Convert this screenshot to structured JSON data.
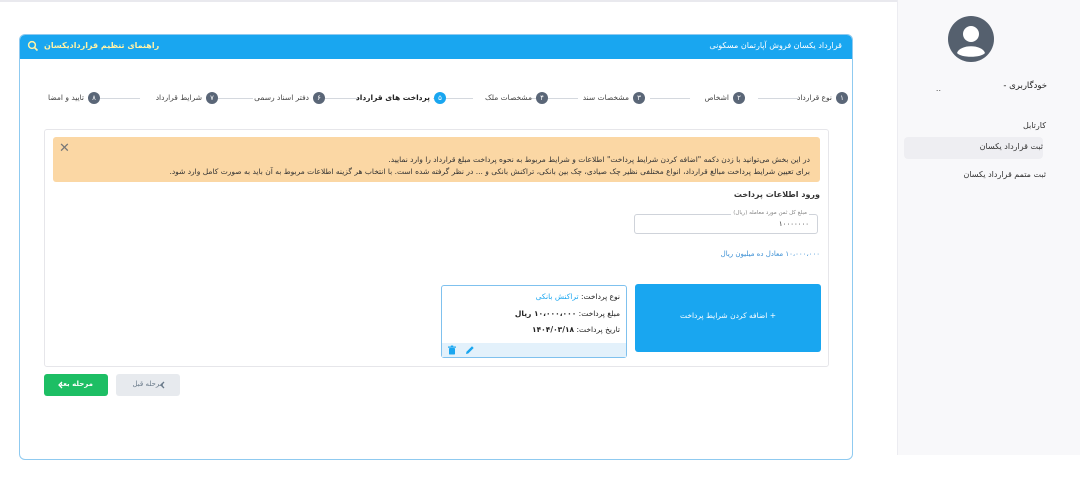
{
  "sidebar": {
    "username": "خودگاربری -",
    "username_dots": "..",
    "items": [
      {
        "label": "کارتابل"
      },
      {
        "label": "ثبت قرارداد یکسان"
      },
      {
        "label": "ثبت متمم قرارداد یکسان"
      }
    ]
  },
  "header": {
    "title": "قرارداد یکسان فروش آپارتمان مسکونی",
    "guide": "راهنمای تنظیم قراردادیکسان"
  },
  "steps": [
    {
      "num": "۱",
      "label": "نوع قرارداد"
    },
    {
      "num": "۲",
      "label": "اشخاص"
    },
    {
      "num": "۳",
      "label": "مشخصات سند"
    },
    {
      "num": "۴",
      "label": "مشخصات ملک"
    },
    {
      "num": "۵",
      "label": "پرداخت های قرارداد"
    },
    {
      "num": "۶",
      "label": "دفتر اسناد رسمی"
    },
    {
      "num": "۷",
      "label": "شرایط قرارداد"
    },
    {
      "num": "۸",
      "label": "تایید و امضا"
    }
  ],
  "alert": {
    "line1": "در این بخش می‌توانید با زدن دکمه \"اضافه کردن شرایط پرداخت\" اطلاعات و شرایط مربوط به نحوه پرداخت مبلغ قرارداد را وارد نمایید.",
    "line2": "برای تعیین شرایط پرداخت مبالغ قرارداد، انواع مختلفی نظیر چک صیادی، چک بین بانکی، تراکنش بانکی و ... در نظر گرفته شده است. با انتخاب هر گزینه اطلاعات مربوط به آن باید به صورت کامل وارد شود."
  },
  "payment": {
    "section_title": "ورود اطلاعات پرداخت",
    "amount_legend": "مبلغ کل ثمن مورد معامله (ریال)",
    "amount_value": "۱۰۰۰۰۰۰۰",
    "amount_words": "۱۰،۰۰۰،۰۰۰ معادل ده میلیون ریال",
    "card": {
      "type_label": "نوع پرداخت:",
      "type_value": "تراکنش بانکی",
      "amount_label": "مبلغ پرداخت:",
      "amount_value": "۱۰،۰۰۰،۰۰۰ ریال",
      "date_label": "تاریخ پرداخت:",
      "date_value": "۱۴۰۴/۰۳/۱۸"
    },
    "add_button": "+ اضافه کردن شرایط پرداخت"
  },
  "nav": {
    "next": "مرحله بعد",
    "prev": "مرحله قبل"
  },
  "colors": {
    "primary": "#19a6f0",
    "success": "#1dbe64",
    "alert_bg": "#fbd7a4",
    "step_inactive": "#5a6677"
  }
}
